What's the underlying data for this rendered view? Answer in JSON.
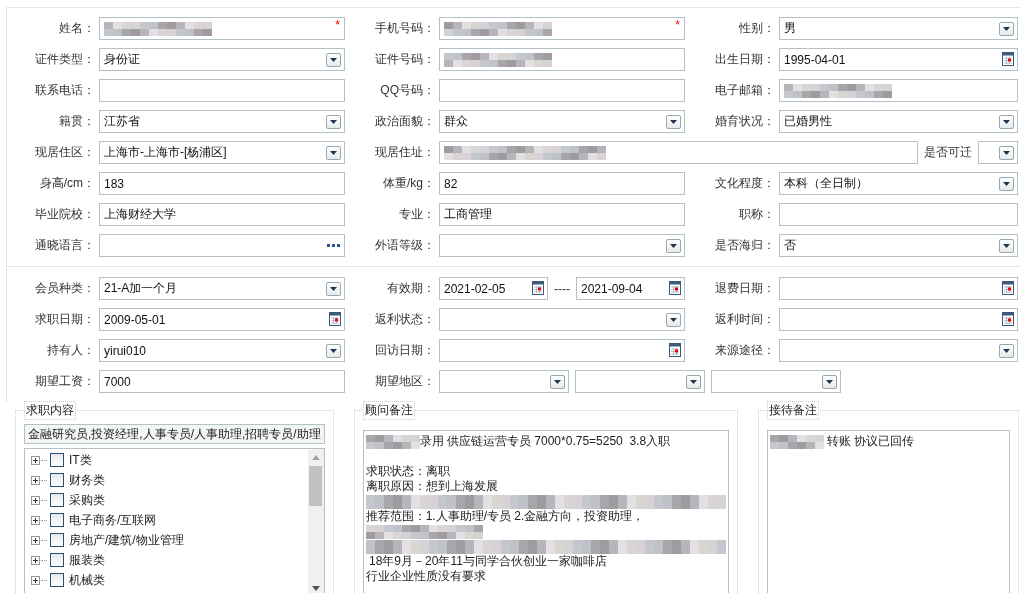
{
  "section_personal": {
    "rows": [
      [
        {
          "label": "姓名：",
          "kind": "text",
          "redacted": true,
          "required": "*"
        },
        {
          "label": "手机号码：",
          "kind": "text",
          "redacted": true,
          "required": "*"
        },
        {
          "label": "性别：",
          "kind": "select",
          "value": "男"
        }
      ],
      [
        {
          "label": "证件类型：",
          "kind": "select",
          "value": "身份证"
        },
        {
          "label": "证件号码：",
          "kind": "text",
          "redacted": true
        },
        {
          "label": "出生日期：",
          "kind": "date",
          "value": "1995-04-01"
        }
      ],
      [
        {
          "label": "联系电话：",
          "kind": "text"
        },
        {
          "label": "QQ号码：",
          "kind": "text"
        },
        {
          "label": "电子邮箱：",
          "kind": "text",
          "redacted": true
        }
      ],
      [
        {
          "label": "籍贯：",
          "kind": "select",
          "value": "江苏省"
        },
        {
          "label": "政治面貌：",
          "kind": "select",
          "value": "群众"
        },
        {
          "label": "婚育状况：",
          "kind": "select",
          "value": "已婚男性"
        }
      ],
      [
        {
          "label": "现居住区：",
          "kind": "select",
          "value": "上海市-上海市-[杨浦区]"
        },
        {
          "label": "现居住址：",
          "kind": "wide_text",
          "redacted": true,
          "extra": {
            "label": "是否可迁",
            "kind": "select"
          }
        }
      ],
      [
        {
          "label": "身高/cm：",
          "kind": "text",
          "value": "183"
        },
        {
          "label": "体重/kg：",
          "kind": "text",
          "value": "82"
        },
        {
          "label": "文化程度：",
          "kind": "select",
          "value": "本科（全日制）"
        }
      ],
      [
        {
          "label": "毕业院校：",
          "kind": "text",
          "value": "上海财经大学"
        },
        {
          "label": "专业：",
          "kind": "text",
          "value": "工商管理"
        },
        {
          "label": "职称：",
          "kind": "text"
        }
      ],
      [
        {
          "label": "通晓语言：",
          "kind": "picker"
        },
        {
          "label": "外语等级：",
          "kind": "select"
        },
        {
          "label": "是否海归：",
          "kind": "select",
          "value": "否"
        }
      ]
    ]
  },
  "section_membership": {
    "rows": [
      [
        {
          "label": "会员种类：",
          "kind": "select",
          "value": "21-A加一个月"
        },
        {
          "label": "有效期：",
          "kind": "date_range",
          "value": "2021-02-05",
          "separator": "----",
          "value_to": "2021-09-04"
        },
        {
          "label": "退费日期：",
          "kind": "date"
        }
      ],
      [
        {
          "label": "求职日期：",
          "kind": "date",
          "value": "2009-05-01"
        },
        {
          "label": "返利状态：",
          "kind": "select"
        },
        {
          "label": "返利时间：",
          "kind": "date"
        }
      ],
      [
        {
          "label": "持有人：",
          "kind": "select",
          "value": "yirui010"
        },
        {
          "label": "回访日期：",
          "kind": "date"
        },
        {
          "label": "来源途径：",
          "kind": "select"
        }
      ],
      [
        {
          "label": "期望工资：",
          "kind": "text",
          "value": "7000"
        },
        {
          "label": "期望地区：",
          "kind": "multi_select",
          "selects": [
            {
              "kind": "select"
            },
            {
              "kind": "select"
            },
            {
              "kind": "select"
            }
          ]
        }
      ]
    ]
  },
  "job_intent": {
    "legend": "求职内容",
    "summary": "金融研究员,投资经理,人事专员/人事助理,招聘专员/助理",
    "tree": [
      {
        "label": "IT类",
        "expanded": false,
        "checked": false
      },
      {
        "label": "财务类",
        "expanded": false,
        "checked": false
      },
      {
        "label": "采购类",
        "expanded": false,
        "checked": false
      },
      {
        "label": "电子商务/互联网",
        "expanded": false,
        "checked": false
      },
      {
        "label": "房地产/建筑/物业管理",
        "expanded": false,
        "checked": false
      },
      {
        "label": "服装类",
        "expanded": false,
        "checked": false
      },
      {
        "label": "机械类",
        "expanded": false,
        "checked": false
      }
    ]
  },
  "advisor_notes": {
    "legend": "顾问备注",
    "lines": [
      {
        "kind": "text",
        "redacted_prefix": true,
        "text": "录用 供应链运营专员 7000*0.75=5250  3.8入职"
      },
      {
        "kind": "blank"
      },
      {
        "kind": "text",
        "text": "求职状态：离职"
      },
      {
        "kind": "text",
        "text": "离职原因：想到上海发展"
      },
      {
        "kind": "redacted"
      },
      {
        "kind": "text",
        "text": "推荐范围：1.人事助理/专员 2.金融方向，投资助理，"
      },
      {
        "kind": "redacted"
      },
      {
        "kind": "redacted"
      },
      {
        "kind": "text",
        "text": " 18年9月－20年11与同学合伙创业一家咖啡店"
      },
      {
        "kind": "text",
        "text": "行业企业性质没有要求"
      }
    ]
  },
  "reception_notes": {
    "legend": "接待备注",
    "lines": [
      {
        "kind": "text",
        "redacted_prefix": true,
        "text": " 转账 协议已回传"
      }
    ]
  }
}
